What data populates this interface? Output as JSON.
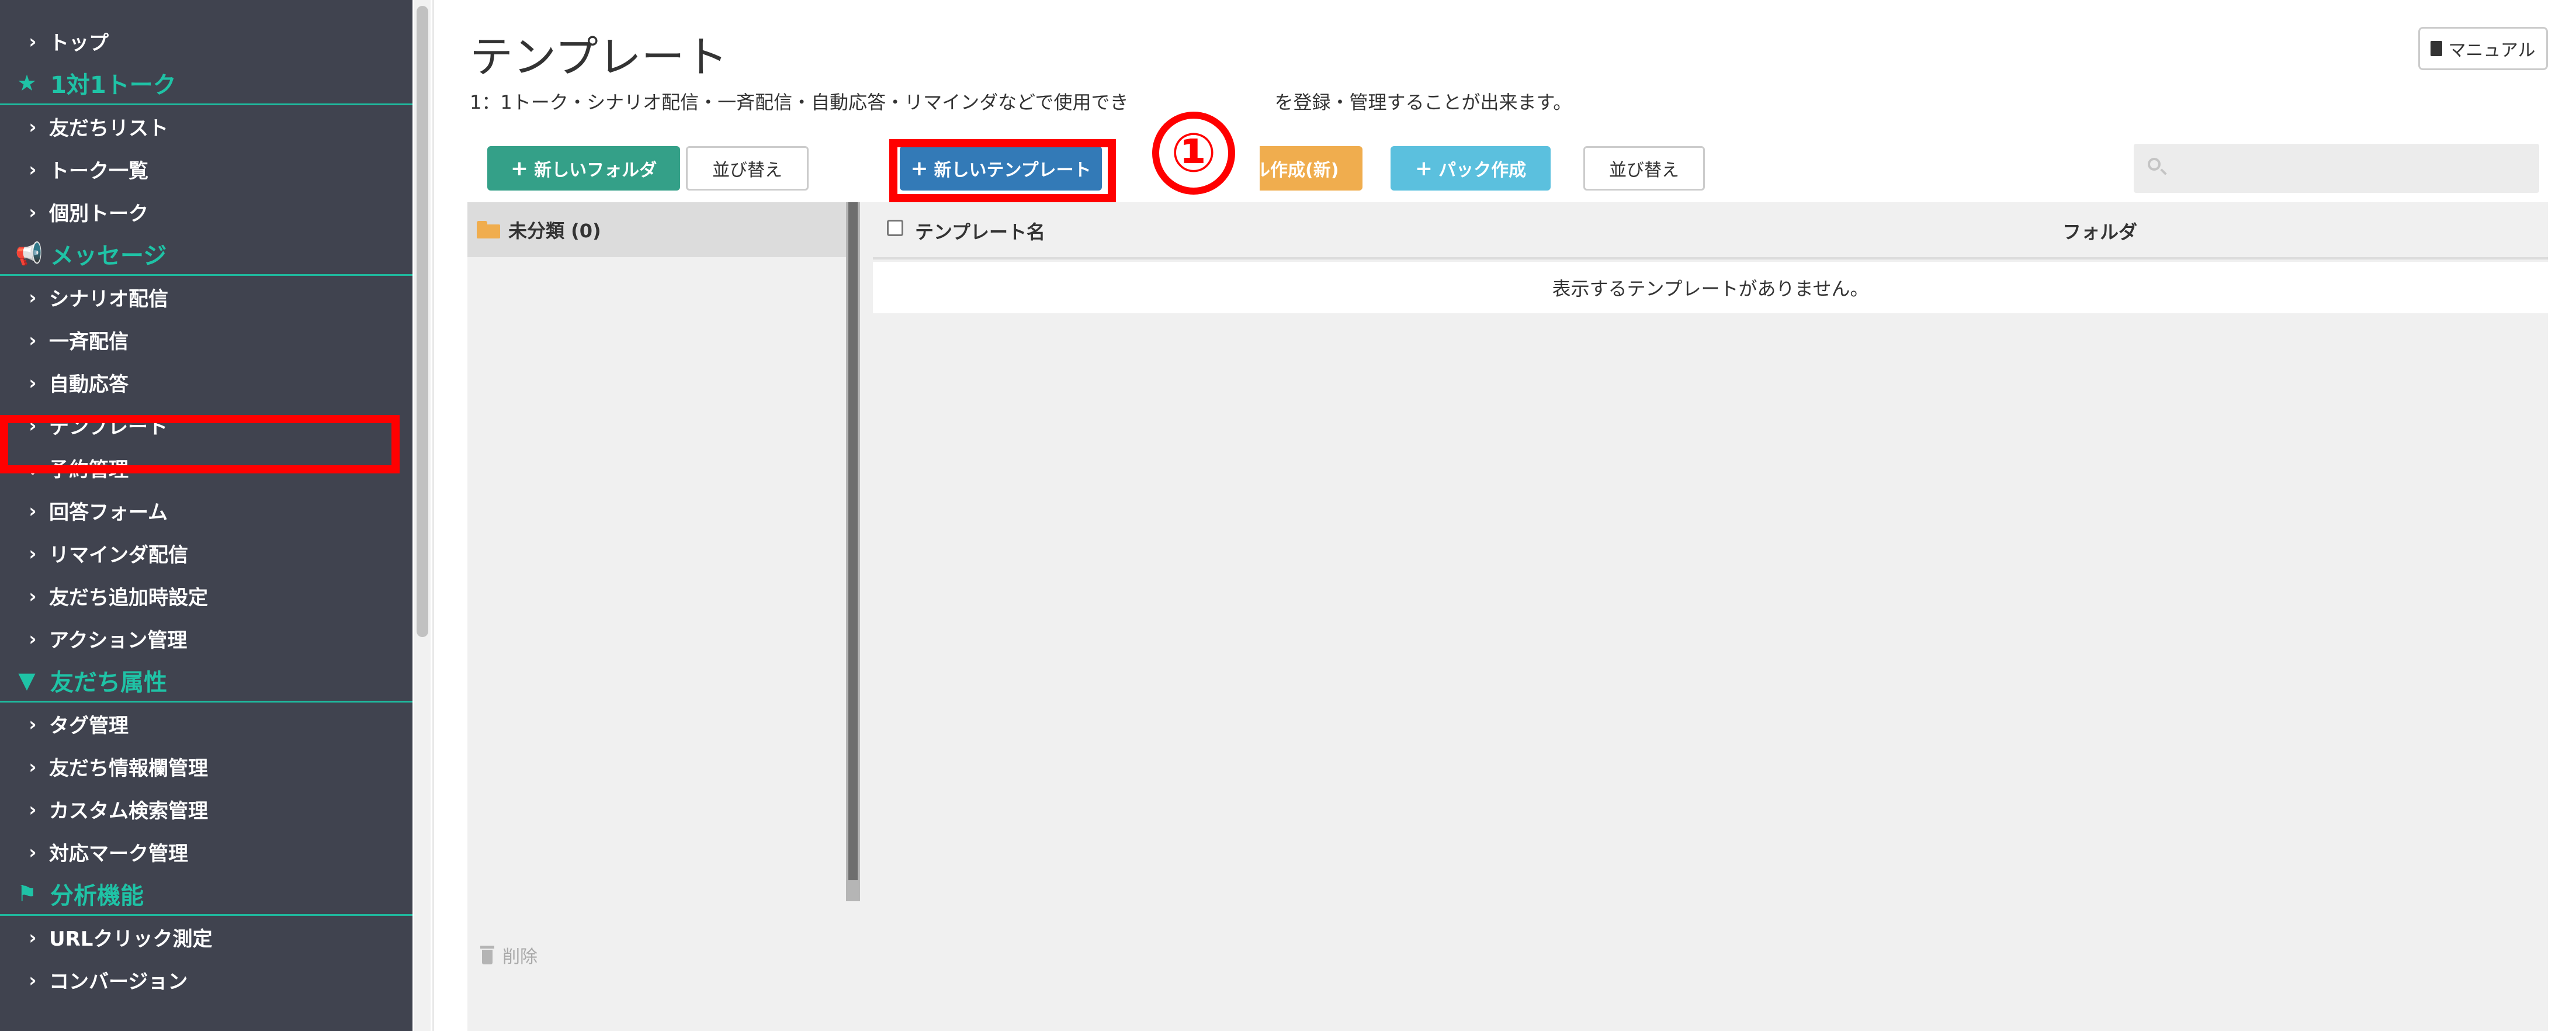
{
  "sidebar": {
    "items": [
      {
        "type": "link",
        "label": "トップ",
        "chevron": "›"
      },
      {
        "type": "header",
        "label": "1対1トーク",
        "icon": "★"
      },
      {
        "type": "link",
        "label": "友だちリスト",
        "chevron": "›"
      },
      {
        "type": "link",
        "label": "トーク一覧",
        "chevron": "›"
      },
      {
        "type": "link",
        "label": "個別トーク",
        "chevron": "›"
      },
      {
        "type": "header",
        "label": "メッセージ",
        "icon": "📢"
      },
      {
        "type": "link",
        "label": "シナリオ配信",
        "chevron": "›"
      },
      {
        "type": "link",
        "label": "一斉配信",
        "chevron": "›"
      },
      {
        "type": "link",
        "label": "自動応答",
        "chevron": "›"
      },
      {
        "type": "link",
        "label": "テンプレート",
        "chevron": "›",
        "highlighted": true
      },
      {
        "type": "link",
        "label": "予約管理",
        "chevron": "⌄"
      },
      {
        "type": "link",
        "label": "回答フォーム",
        "chevron": "›"
      },
      {
        "type": "link",
        "label": "リマインダ配信",
        "chevron": "›"
      },
      {
        "type": "link",
        "label": "友だち追加時設定",
        "chevron": "›"
      },
      {
        "type": "link",
        "label": "アクション管理",
        "chevron": "›"
      },
      {
        "type": "header",
        "label": "友だち属性",
        "icon": "▼"
      },
      {
        "type": "link",
        "label": "タグ管理",
        "chevron": "›"
      },
      {
        "type": "link",
        "label": "友だち情報欄管理",
        "chevron": "›"
      },
      {
        "type": "link",
        "label": "カスタム検索管理",
        "chevron": "›"
      },
      {
        "type": "link",
        "label": "対応マーク管理",
        "chevron": "›"
      },
      {
        "type": "header",
        "label": "分析機能",
        "icon": "⚑"
      },
      {
        "type": "link",
        "label": "URLクリック測定",
        "chevron": "›"
      },
      {
        "type": "link",
        "label": "コンバージョン",
        "chevron": "›"
      }
    ]
  },
  "header": {
    "title": "テンプレート",
    "description_visible_left": "1：1トーク・シナリオ配信・一斉配信・自動応答・リマインダなどで使用でき",
    "description_visible_right": "を登録・管理することが出来ます。",
    "manual_label": "マニュアル"
  },
  "toolbar": {
    "new_folder_label": "新しいフォルダ",
    "sort_folder_label": "並び替え",
    "new_template_label": "新しいテンプレート",
    "orange_button_visible_label": "ル作成(新)",
    "pack_label": "パック作成",
    "sort_template_label": "並び替え",
    "search_placeholder": ""
  },
  "annotation": {
    "callout_number": "①",
    "highlight_color": "#ff0000"
  },
  "folders": {
    "uncategorized_label": "未分類 (0)",
    "delete_label": "削除"
  },
  "table": {
    "columns": [
      "テンプレート名",
      "フォルダ"
    ],
    "empty_message": "表示するテンプレートがありません。"
  },
  "colors": {
    "sidebar_bg": "#40434f",
    "sidebar_accent": "#1fc3a6",
    "green_button": "#34a088",
    "blue_button": "#337ab7",
    "orange_button": "#f0ad4e",
    "cyan_button": "#5bc0de"
  }
}
